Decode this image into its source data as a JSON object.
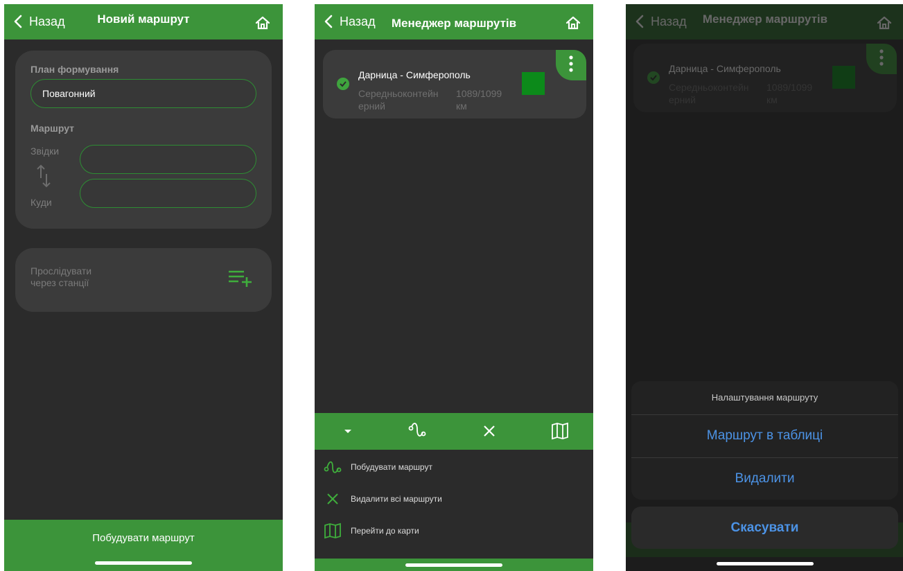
{
  "colors": {
    "green": "#3c943a",
    "background": "#2b2b2b",
    "card": "#3b3b3b",
    "accent_blue": "#4c93e6",
    "route_color": "#0c8a1a"
  },
  "new_route": {
    "back_label": "Назад",
    "title": "Новий маршрут",
    "plan_label": "План формування",
    "plan_value": "Повагонний",
    "route_label": "Маршрут",
    "from_label": "Звідки",
    "to_label": "Куди",
    "from_value": "",
    "to_value": "",
    "via_label_line1": "Прослідувати",
    "via_label_line2": "через станції",
    "build_button": "Побудувати маршрут"
  },
  "manager": {
    "back_label": "Назад",
    "title": "Менеджер маршрутів",
    "route": {
      "name": "Дарница - Симферополь",
      "type_line1": "Середньоконтейн",
      "type_line2": "ерний",
      "distance_line1": "1089/1099",
      "distance_line2": "км"
    },
    "toolbar_icons": [
      "chevron-down-icon",
      "route-curve-icon",
      "close-icon",
      "map-icon"
    ],
    "legend": [
      {
        "icon": "route-curve-icon",
        "label": "Побудувати маршрут"
      },
      {
        "icon": "close-icon",
        "label": "Видалити всі маршрути"
      },
      {
        "icon": "map-icon",
        "label": "Перейти до карти"
      }
    ]
  },
  "action_sheet": {
    "title": "Налаштування маршруту",
    "items": [
      "Маршрут в таблиці",
      "Видалити"
    ],
    "cancel": "Скасувати"
  }
}
